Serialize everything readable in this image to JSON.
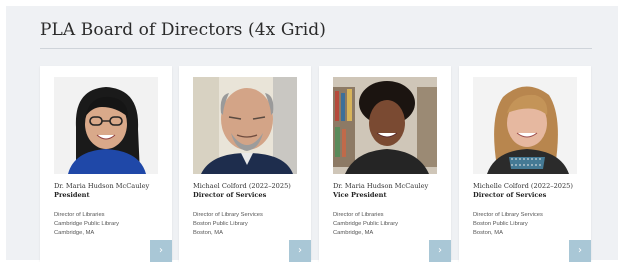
{
  "page": {
    "heading": "PLA Board of Directors (4x Grid)"
  },
  "cards": [
    {
      "name": "Dr. Maria Hudson McCauley",
      "title": "President",
      "role": "Director of Libraries",
      "org": "Cambridge Public Library",
      "location": "Cambridge, MA",
      "more_icon": "›"
    },
    {
      "name": "Michael Colford (2022–2025)",
      "title": "Director of Services",
      "role": "Director of Library Services",
      "org": "Boston Public Library",
      "location": "Boston, MA",
      "more_icon": "›"
    },
    {
      "name": "Dr. Maria Hudson McCauley",
      "title": "Vice President",
      "role": "Director of Libraries",
      "org": "Cambridge Public Library",
      "location": "Cambridge, MA",
      "more_icon": "›"
    },
    {
      "name": "Michelle Colford (2022–2025)",
      "title": "Director of Services",
      "role": "Director of Library Services",
      "org": "Boston Public Library",
      "location": "Boston, MA",
      "more_icon": "›"
    }
  ],
  "colors": {
    "panel": "#eff1f4",
    "button": "#a9c7d6",
    "rule": "#cfd4da"
  }
}
